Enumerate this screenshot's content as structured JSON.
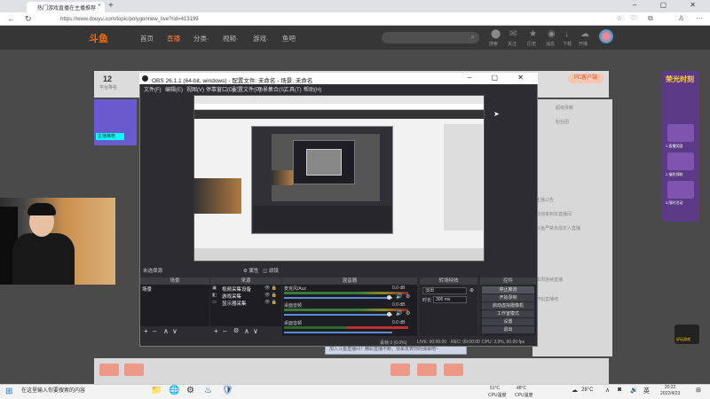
{
  "browser": {
    "tab_title": "热门游戏直播在主播推荐 ·",
    "tab_close": "×",
    "new_tab": "+",
    "window_controls": "– ▢ ✕",
    "url": "https://www.douyu.com/topic/polygonnew_live?rid=413199",
    "nav_back": "←",
    "nav_refresh": "↻",
    "icons": [
      "☆",
      "♡",
      "⧉",
      "♙",
      "⋯"
    ]
  },
  "site": {
    "logo": "斗鱼",
    "nav": [
      "首页",
      "直播",
      "分类·",
      "视频·",
      "游戏·",
      "鱼吧"
    ],
    "active_nav": "直播",
    "header_icons": [
      "⬤",
      "✉",
      "★",
      "◉",
      "↓",
      "☁"
    ],
    "header_labels": [
      "搜索",
      "关注",
      "历史",
      "消息",
      "下载",
      "开播"
    ],
    "count": "12",
    "count_label": "平台排名",
    "pc_button": "PC客户端",
    "left_thumb_badge": "主播推荐",
    "right_panel": [
      "超级贡献",
      "粉丝团",
      "主播公告",
      "欢迎来到本直播间",
      "斗鱼严禁未成年人直播",
      "本周连续直播",
      "开始直播吧"
    ],
    "side_ad_title": "荣光时刻",
    "side_ad_rows": [
      "1.直播奖励",
      "2.福利领取",
      "3.限时活动"
    ],
    "badge_text": "好玩游戏",
    "tooltip": "加入斗鱼直播间！精彩直播不断，快来发表你的弹幕吧~"
  },
  "obs": {
    "title": "OBS 26.1.1 (64-bit, windows) - 配置文件: 未命名 - 场景: 未命名",
    "menu": [
      "文件(F)",
      "编辑(E)",
      "视图(V)",
      "停靠窗口(D)",
      "配置文件(P)",
      "场景集合(S)",
      "工具(T)",
      "帮助(H)"
    ],
    "toolbar_label": "未选择源",
    "toolbar_buttons": [
      "⚙ 属性",
      "◫ 滤镜"
    ],
    "docks": {
      "scenes": "场景",
      "sources": "来源",
      "mixer": "混音器",
      "transitions": "转场特效",
      "controls": "控件"
    },
    "scene_items": [
      "场景"
    ],
    "source_items": [
      "视频采集设备",
      "游戏采集",
      "显示器采集"
    ],
    "source_icons": "👁 🔒",
    "mixer_tracks": [
      {
        "name": "麦克风/Aux",
        "db": "0.0 dB"
      },
      {
        "name": "桌面音频",
        "db": "0.0 dB"
      },
      {
        "name": "桌面音频",
        "db": "0.0 dB"
      }
    ],
    "transition_select": "淡出",
    "duration_label": "时长",
    "duration_value": "300 ms",
    "control_buttons": [
      "停止推流",
      "开始录制",
      "启动虚拟摄像机",
      "工作室模式",
      "设置",
      "退出"
    ],
    "status": [
      "丢帧 0 (0.0%)",
      "LIVE: 00:00:00",
      "REC: 00:00:00",
      "CPU: 3.9%, 60.00 fps"
    ],
    "dock_footer_buttons": [
      "+",
      "–",
      "∧",
      "∨"
    ]
  },
  "taskbar": {
    "start": "⊞",
    "search": "在这里输入你要搜索的内容",
    "apps": [
      "📁",
      "🌐",
      "⚙",
      "♨",
      "🛡"
    ],
    "weather": [
      {
        "temp": "51°C",
        "label": "CPU温度"
      },
      {
        "temp": "48°C",
        "label": "CPU温度"
      }
    ],
    "outside_temp": "28°C",
    "tray": [
      "☁",
      "∧",
      "◙",
      "🔊",
      "英",
      "⊞"
    ],
    "time": "20:22",
    "date": "2022/4/23"
  },
  "colors": {
    "accent": "#ff7a3a",
    "obs_bg": "#2c2c31",
    "stop_stream": "#54545e"
  }
}
